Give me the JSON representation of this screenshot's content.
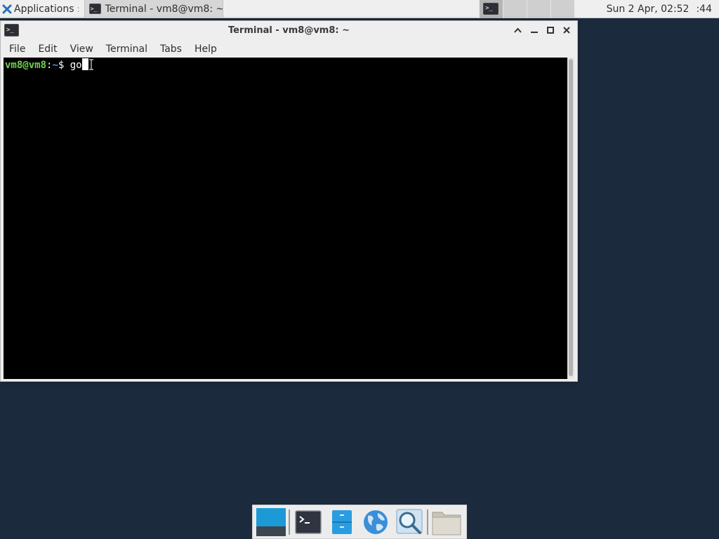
{
  "top_panel": {
    "applications_label": "Applications",
    "applications_sep": ":",
    "task_title": "Terminal - vm8@vm8: ~",
    "clock": "Sun  2 Apr, 02:52",
    "clock_seconds": ":44",
    "icons": [
      "xfce-logo-icon",
      "terminal-icon"
    ]
  },
  "window": {
    "title": "Terminal - vm8@vm8: ~",
    "icon_text": ">_",
    "menu": [
      "File",
      "Edit",
      "View",
      "Terminal",
      "Tabs",
      "Help"
    ]
  },
  "terminal": {
    "prompt_user": "vm8@vm8",
    "prompt_colon": ":",
    "prompt_path": "~",
    "prompt_symbol": "$ ",
    "command": "go",
    "colors": {
      "user": "#6fd24a",
      "path": "#5b8fe0",
      "background": "#000000",
      "text": "#ffffff"
    }
  },
  "dock": {
    "items": [
      "show-desktop-icon",
      "terminal-icon",
      "file-manager-icon",
      "web-browser-icon",
      "app-finder-icon",
      "folder-icon"
    ]
  }
}
